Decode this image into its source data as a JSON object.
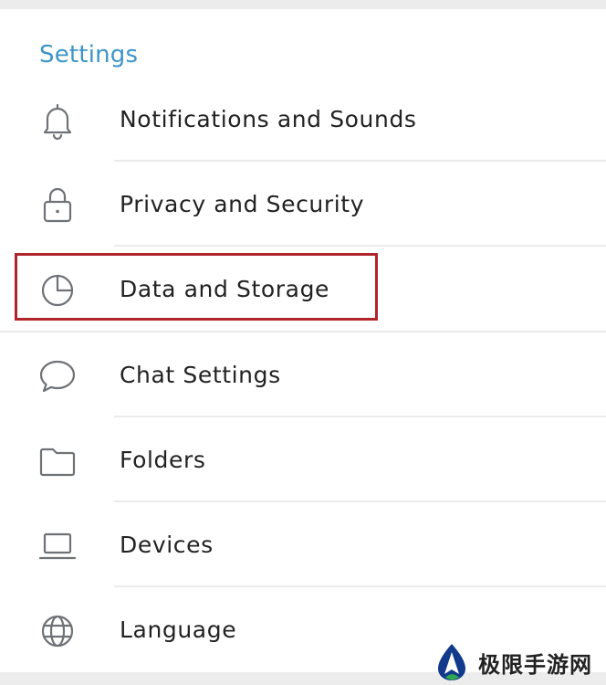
{
  "header": {
    "title": "Settings"
  },
  "items": [
    {
      "label": "Notifications and Sounds",
      "icon": "bell-icon"
    },
    {
      "label": "Privacy and Security",
      "icon": "lock-icon"
    },
    {
      "label": "Data and Storage",
      "icon": "pie-chart-icon",
      "highlighted": true
    },
    {
      "label": "Chat Settings",
      "icon": "chat-bubble-icon"
    },
    {
      "label": "Folders",
      "icon": "folder-icon"
    },
    {
      "label": "Devices",
      "icon": "laptop-icon"
    },
    {
      "label": "Language",
      "icon": "globe-icon"
    }
  ],
  "colors": {
    "accent": "#3d95c9",
    "text": "#222222",
    "icon": "#6e7276",
    "highlight": "#b0242c",
    "divider": "#ebebeb"
  },
  "watermark": {
    "text": "极限手游网"
  }
}
